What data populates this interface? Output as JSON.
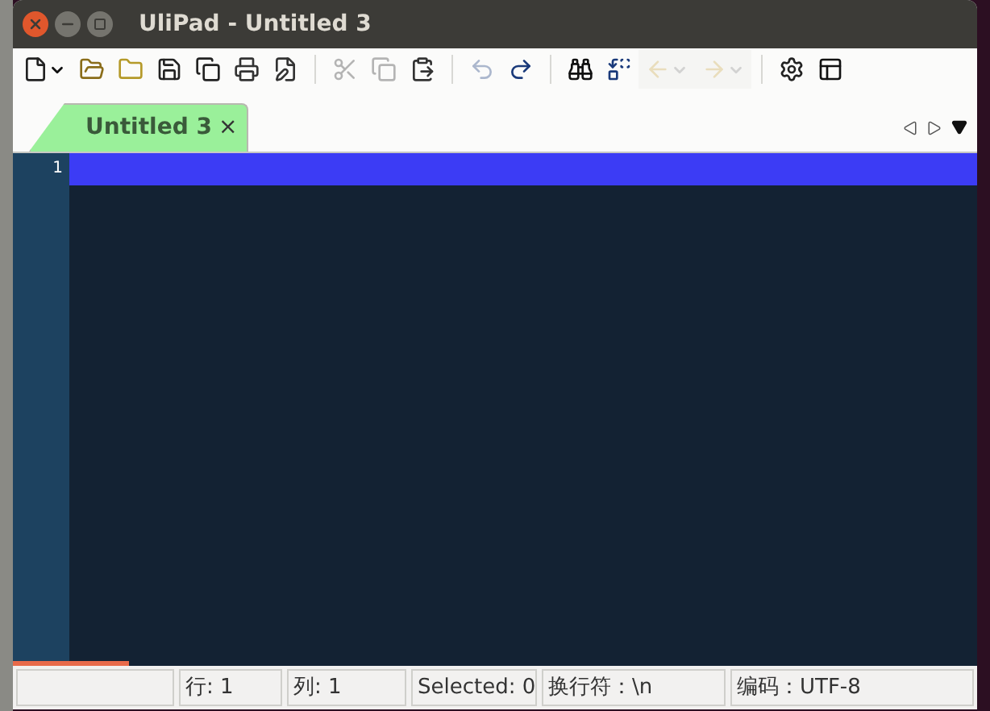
{
  "window": {
    "title": "UliPad - Untitled 3"
  },
  "toolbar": [
    {
      "kind": "button",
      "disabled": false,
      "dropdown": true
    },
    {
      "kind": "button",
      "disabled": false,
      "dropdown": false
    },
    {
      "kind": "button",
      "disabled": false,
      "dropdown": false
    },
    {
      "kind": "button",
      "disabled": false,
      "dropdown": false
    },
    {
      "kind": "button",
      "disabled": false,
      "dropdown": false
    },
    {
      "kind": "button",
      "disabled": false,
      "dropdown": false
    },
    {
      "kind": "button",
      "disabled": false,
      "dropdown": false
    },
    {
      "kind": "separator"
    },
    {
      "kind": "button",
      "disabled": true,
      "dropdown": false
    },
    {
      "kind": "button",
      "disabled": true,
      "dropdown": false
    },
    {
      "kind": "button",
      "disabled": false,
      "dropdown": false
    },
    {
      "kind": "separator"
    },
    {
      "kind": "button",
      "disabled": true,
      "dropdown": false
    },
    {
      "kind": "button",
      "disabled": false,
      "dropdown": false
    },
    {
      "kind": "separator"
    },
    {
      "kind": "button",
      "disabled": false,
      "dropdown": false
    },
    {
      "kind": "button",
      "disabled": false,
      "dropdown": false
    },
    {
      "kind": "button",
      "disabled": true,
      "dropdown": true
    },
    {
      "kind": "button",
      "disabled": true,
      "dropdown": true
    },
    {
      "kind": "separator"
    },
    {
      "kind": "button",
      "disabled": false,
      "dropdown": false
    },
    {
      "kind": "button",
      "disabled": false,
      "dropdown": false
    }
  ],
  "tabs": [
    {
      "label": "Untitled 3",
      "selected": true,
      "close": "×"
    }
  ],
  "editor": {
    "line_numbers": [
      "1"
    ],
    "progress": {
      "level": 0.12
    }
  },
  "status_bar": [
    "行: 1",
    "列: 1",
    "Selected: 0",
    "换行符：\\n",
    "编码：UTF-8"
  ]
}
